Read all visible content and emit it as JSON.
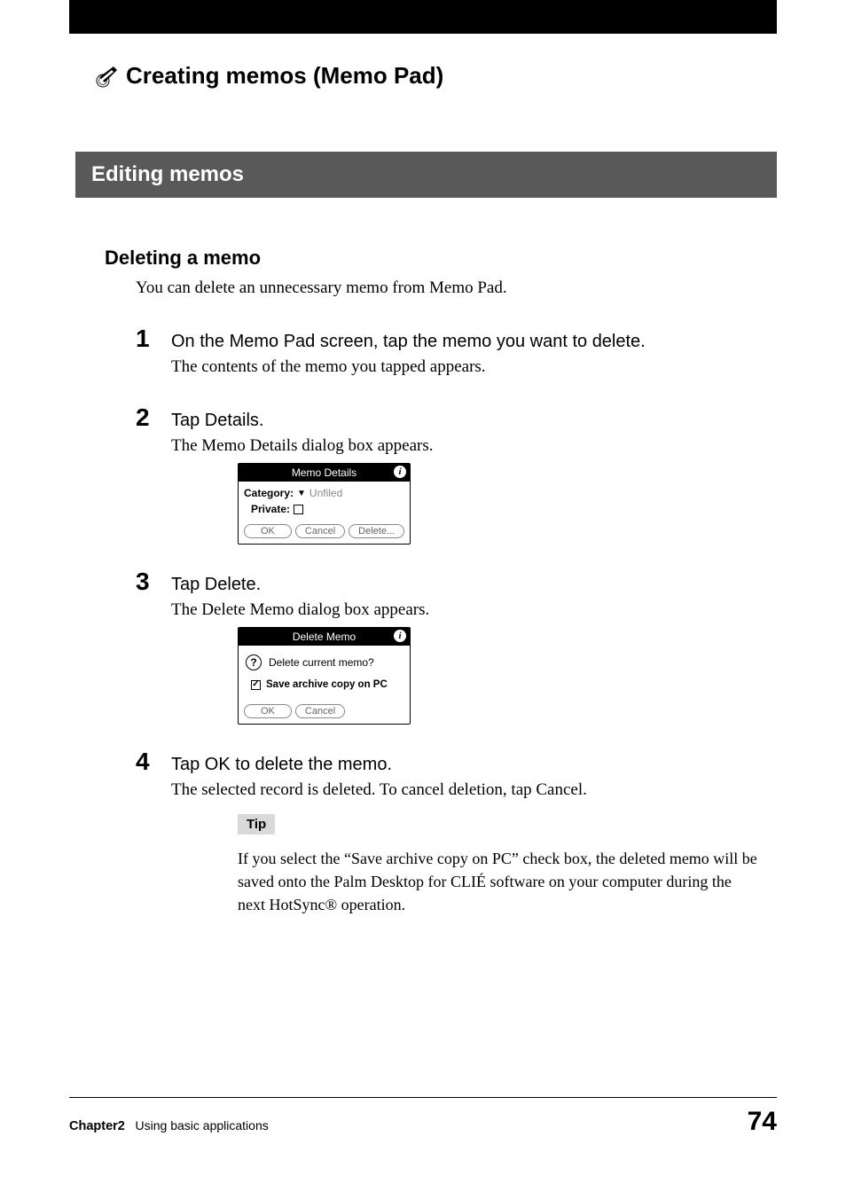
{
  "chapter_title": "Creating memos (Memo Pad)",
  "section_banner": "Editing memos",
  "subsection": "Deleting a memo",
  "intro": "You can delete an unnecessary memo from Memo Pad.",
  "steps": [
    {
      "num": "1",
      "instruction": "On the Memo Pad screen, tap the memo you want to delete.",
      "detail": "The contents of the memo you tapped appears."
    },
    {
      "num": "2",
      "instruction": "Tap Details.",
      "detail": "The Memo Details dialog box appears."
    },
    {
      "num": "3",
      "instruction": "Tap Delete.",
      "detail": "The Delete Memo dialog box appears."
    },
    {
      "num": "4",
      "instruction": "Tap OK to delete the memo.",
      "detail": "The selected record is deleted. To cancel deletion, tap Cancel."
    }
  ],
  "dialog1": {
    "title": "Memo Details",
    "category_label": "Category:",
    "category_value": "Unfiled",
    "private_label": "Private:",
    "ok": "OK",
    "cancel": "Cancel",
    "delete": "Delete..."
  },
  "dialog2": {
    "title": "Delete Memo",
    "question_mark": "?",
    "question": "Delete current memo?",
    "archive_label": "Save archive copy on PC",
    "ok": "OK",
    "cancel": "Cancel"
  },
  "tip": {
    "label": "Tip",
    "text": "If you select the “Save archive copy on PC” check box, the deleted memo will be saved onto the Palm Desktop for CLIÉ software on your computer during the next HotSync® operation."
  },
  "footer": {
    "chapter": "Chapter2",
    "name": "Using basic applications",
    "page": "74"
  },
  "info_i": "i"
}
